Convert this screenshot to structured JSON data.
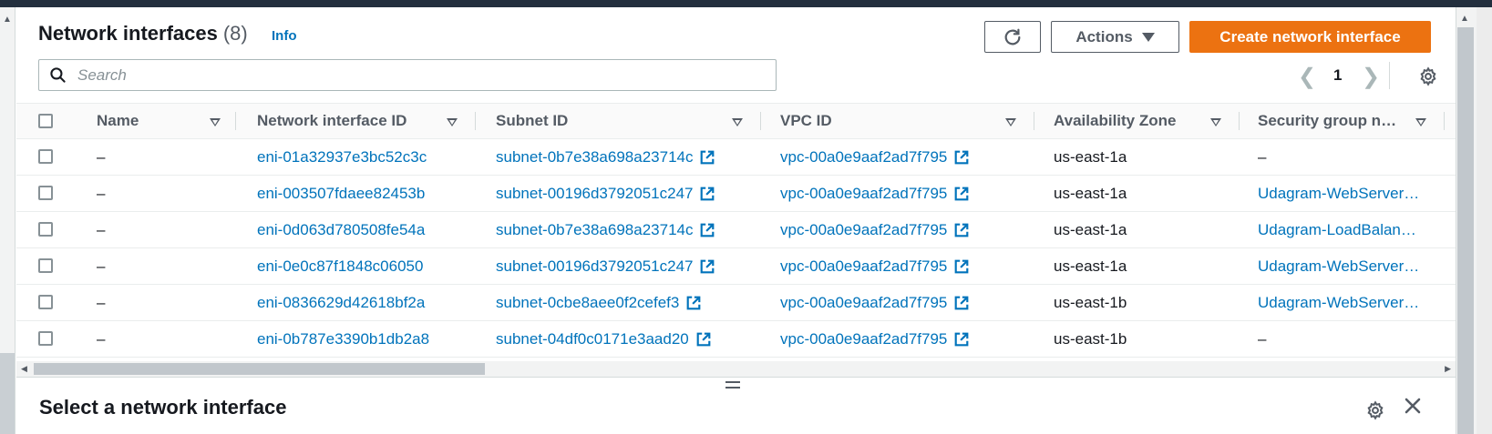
{
  "header": {
    "title": "Network interfaces",
    "count": "(8)",
    "info": "Info",
    "actions_label": "Actions",
    "create_label": "Create network interface"
  },
  "search": {
    "placeholder": "Search",
    "value": ""
  },
  "pagination": {
    "current_page": "1"
  },
  "table": {
    "columns": [
      "Name",
      "Network interface ID",
      "Subnet ID",
      "VPC ID",
      "Availability Zone",
      "Security group n…"
    ],
    "rows": [
      {
        "name": "–",
        "eni": "eni-01a32937e3bc52c3c",
        "subnet": "subnet-0b7e38a698a23714c",
        "vpc": "vpc-00a0e9aaf2ad7f795",
        "az": "us-east-1a",
        "sg": "–"
      },
      {
        "name": "–",
        "eni": "eni-003507fdaee82453b",
        "subnet": "subnet-00196d3792051c247",
        "vpc": "vpc-00a0e9aaf2ad7f795",
        "az": "us-east-1a",
        "sg": "Udagram-WebServer…"
      },
      {
        "name": "–",
        "eni": "eni-0d063d780508fe54a",
        "subnet": "subnet-0b7e38a698a23714c",
        "vpc": "vpc-00a0e9aaf2ad7f795",
        "az": "us-east-1a",
        "sg": "Udagram-LoadBalan…"
      },
      {
        "name": "–",
        "eni": "eni-0e0c87f1848c06050",
        "subnet": "subnet-00196d3792051c247",
        "vpc": "vpc-00a0e9aaf2ad7f795",
        "az": "us-east-1a",
        "sg": "Udagram-WebServer…"
      },
      {
        "name": "–",
        "eni": "eni-0836629d42618bf2a",
        "subnet": "subnet-0cbe8aee0f2cefef3",
        "vpc": "vpc-00a0e9aaf2ad7f795",
        "az": "us-east-1b",
        "sg": "Udagram-WebServer…"
      },
      {
        "name": "–",
        "eni": "eni-0b787e3390b1db2a8",
        "subnet": "subnet-04df0c0171e3aad20",
        "vpc": "vpc-00a0e9aaf2ad7f795",
        "az": "us-east-1b",
        "sg": "–"
      }
    ]
  },
  "split_panel": {
    "title": "Select a network interface"
  },
  "colors": {
    "accent": "#ec7211",
    "link": "#0073bb",
    "text": "#16191f",
    "muted": "#545b64"
  },
  "icons": [
    "refresh-icon",
    "caret-down-icon",
    "search-icon",
    "chevron-left-icon",
    "chevron-right-icon",
    "settings-icon",
    "sort-icon",
    "external-link-icon",
    "close-icon",
    "drag-handle-icon"
  ]
}
